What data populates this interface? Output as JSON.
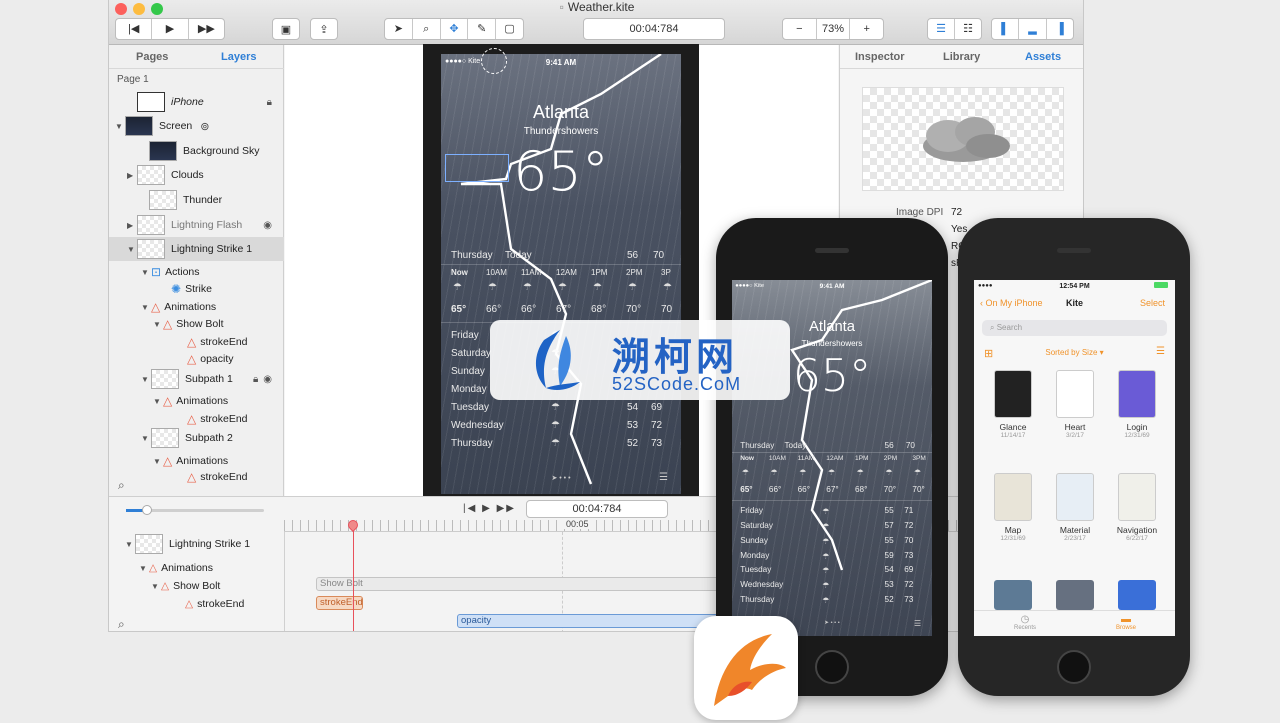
{
  "window": {
    "title": "Weather.kite",
    "time": "00:04:784",
    "zoom": "73%"
  },
  "toolbar": {
    "zoom_minus": "−",
    "zoom_plus": "+"
  },
  "left_tabs": {
    "pages": "Pages",
    "layers": "Layers"
  },
  "page_label": "Page 1",
  "layers": [
    {
      "label": "iPhone"
    },
    {
      "label": "Screen"
    },
    {
      "label": "Background Sky"
    },
    {
      "label": "Clouds"
    },
    {
      "label": "Thunder"
    },
    {
      "label": "Lightning Flash"
    },
    {
      "label": "Lightning Strike 1"
    },
    {
      "label": "Actions"
    },
    {
      "label": "Strike"
    },
    {
      "label": "Animations"
    },
    {
      "label": "Show Bolt"
    },
    {
      "label": "strokeEnd"
    },
    {
      "label": "opacity"
    },
    {
      "label": "Subpath 1"
    },
    {
      "label": "Animations"
    },
    {
      "label": "strokeEnd"
    },
    {
      "label": "Subpath 2"
    },
    {
      "label": "Animations"
    },
    {
      "label": "strokeEnd"
    }
  ],
  "right_tabs": {
    "inspector": "Inspector",
    "library": "Library",
    "assets": "Assets"
  },
  "asset": {
    "dpi_label": "Image DPI",
    "dpi_value": "72",
    "partial_value1": "Yes",
    "partial_value2": "RG",
    "partial_value3": "sR"
  },
  "timeline": {
    "time": "00:04:784",
    "ruler_label": "00:05",
    "rows": [
      {
        "label": "Lightning Strike 1"
      },
      {
        "label": "Animations"
      },
      {
        "label": "Show Bolt"
      },
      {
        "label": "strokeEnd"
      }
    ],
    "bars": {
      "show_bolt": "Show Bolt",
      "stroke_end": "strokeEnd",
      "opacity": "opacity"
    }
  },
  "weather_large": {
    "carrier": "●●●●○ Kite",
    "clock": "9:41 AM",
    "city": "Atlanta",
    "condition": "Thundershowers",
    "temp": "65°",
    "day": "Thursday",
    "today": "Today",
    "hi": "56",
    "lo": "70",
    "hours": [
      "Now",
      "10AM",
      "11AM",
      "12AM",
      "1PM",
      "2PM",
      "3P"
    ],
    "hour_temps": [
      "65°",
      "66°",
      "66°",
      "67°",
      "68°",
      "70°",
      "70"
    ],
    "days": [
      {
        "d": "Friday",
        "lo": "",
        "hi": ""
      },
      {
        "d": "Saturday",
        "lo": "",
        "hi": ""
      },
      {
        "d": "Sunday",
        "lo": "",
        "hi": ""
      },
      {
        "d": "Monday",
        "lo": "",
        "hi": ""
      },
      {
        "d": "Tuesday",
        "lo": "54",
        "hi": "69"
      },
      {
        "d": "Wednesday",
        "lo": "53",
        "hi": "72"
      },
      {
        "d": "Thursday",
        "lo": "52",
        "hi": "73"
      }
    ]
  },
  "weather_small": {
    "carrier": "●●●●○ Kite",
    "clock": "9:41 AM",
    "city": "Atlanta",
    "condition": "Thundershowers",
    "temp": "65°",
    "day": "Thursday",
    "today": "Today",
    "hi": "56",
    "lo": "70",
    "hours": [
      "Now",
      "10AM",
      "11AM",
      "12AM",
      "1PM",
      "2PM",
      "3PM"
    ],
    "hour_temps": [
      "65°",
      "66°",
      "66°",
      "67°",
      "68°",
      "70°",
      "70°"
    ],
    "days": [
      {
        "d": "Friday",
        "lo": "55",
        "hi": "71"
      },
      {
        "d": "Saturday",
        "lo": "57",
        "hi": "72"
      },
      {
        "d": "Sunday",
        "lo": "55",
        "hi": "70"
      },
      {
        "d": "Monday",
        "lo": "59",
        "hi": "73"
      },
      {
        "d": "Tuesday",
        "lo": "54",
        "hi": "69"
      },
      {
        "d": "Wednesday",
        "lo": "53",
        "hi": "72"
      },
      {
        "d": "Thursday",
        "lo": "52",
        "hi": "73"
      }
    ]
  },
  "files_app": {
    "clock": "12:54 PM",
    "back": "On My iPhone",
    "title": "Kite",
    "select": "Select",
    "search": "Search",
    "sort": "Sorted by Size ▾",
    "files": [
      {
        "name": "Glance",
        "date": "11/14/17"
      },
      {
        "name": "Heart",
        "date": "3/2/17"
      },
      {
        "name": "Login",
        "date": "12/31/69"
      },
      {
        "name": "Map",
        "date": "12/31/69"
      },
      {
        "name": "Material",
        "date": "2/23/17"
      },
      {
        "name": "Navigation",
        "date": "6/22/17"
      }
    ],
    "tab_recents": "Recents",
    "tab_browse": "Browse"
  },
  "watermark": {
    "cn": "溯柯网",
    "en": "52SCode.CoM"
  },
  "colors": {
    "accent": "#2f7fd6",
    "anim": "#e8624a",
    "ios_orange": "#f0932b",
    "bar_orange": "#f6d9c4",
    "bar_blue": "#cfe0f6"
  }
}
